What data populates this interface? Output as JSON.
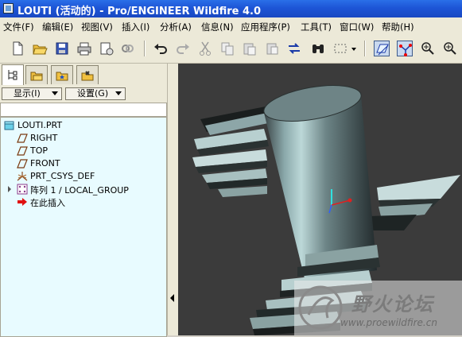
{
  "window": {
    "title": "LOUTI (活动的) - Pro/ENGINEER Wildfire 4.0"
  },
  "menu": [
    {
      "id": "file",
      "label": "文件(F)"
    },
    {
      "id": "edit",
      "label": "编辑(E)"
    },
    {
      "id": "view",
      "label": "视图(V)"
    },
    {
      "id": "insert",
      "label": "插入(I)"
    },
    {
      "id": "analysis",
      "label": "分析(A)"
    },
    {
      "id": "info",
      "label": "信息(N)"
    },
    {
      "id": "applications",
      "label": "应用程序(P)"
    },
    {
      "id": "tools",
      "label": "工具(T)"
    },
    {
      "id": "window",
      "label": "窗口(W)"
    },
    {
      "id": "help",
      "label": "帮助(H)"
    }
  ],
  "toolbar": {
    "icons": [
      "new-icon",
      "open-icon",
      "save-icon",
      "print-icon",
      "email-icon",
      "link-icon",
      "undo-icon",
      "redo-icon",
      "cut-icon",
      "copy-icon",
      "paste-icon",
      "paste-special-icon",
      "regenerate-icon",
      "find-icon",
      "select-box-icon",
      "datum-plane-display-icon",
      "datum-axis-display-icon",
      "datum-point-display-icon",
      "zoom-in-icon"
    ]
  },
  "panel": {
    "tabs": [
      "model-tree-icon",
      "folder-browser-icon",
      "favorites-icon",
      "connections-icon"
    ],
    "show_label": "显示(I)",
    "settings_label": "设置(G)"
  },
  "tree": {
    "items": [
      {
        "label": "LOUTI.PRT",
        "icon": "part-icon"
      },
      {
        "label": "RIGHT",
        "icon": "datum-plane-icon"
      },
      {
        "label": "TOP",
        "icon": "datum-plane-icon"
      },
      {
        "label": "FRONT",
        "icon": "datum-plane-icon"
      },
      {
        "label": "PRT_CSYS_DEF",
        "icon": "coordinate-system-icon"
      },
      {
        "label": "阵列 1 / LOCAL_GROUP",
        "icon": "pattern-icon"
      },
      {
        "label": "在此插入",
        "icon": "insert-here-icon"
      }
    ]
  },
  "watermark": {
    "name": "野火论坛",
    "url": "www.proewildfire.cn"
  },
  "colors": {
    "title_bar": "#1d55d6",
    "tree_background": "#e8fbff",
    "viewport_background": "#3b3b3b",
    "insert_arrow": "#e01010"
  }
}
